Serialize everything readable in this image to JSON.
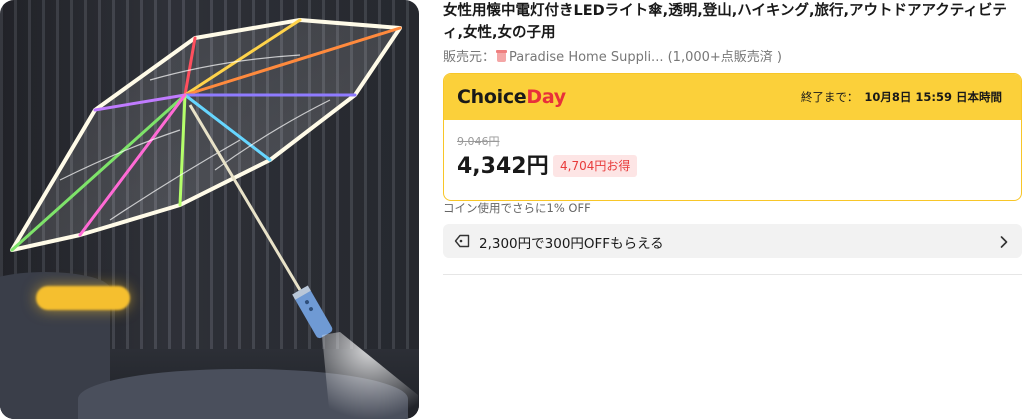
{
  "product": {
    "title": "女性用懐中電灯付きLEDライト傘,透明,登山,ハイキング,旅行,アウトドアアクティビティ,女性,女の子用",
    "seller_prefix": "販売元：",
    "seller_name": "Paradise Home Suppli...",
    "sold_count": "(1,000+点販売済 )"
  },
  "deal": {
    "brand_part1": "Choice",
    "brand_part2": "Day",
    "countdown_label": "終了まで：",
    "countdown_time": "10月8日 15:59 日本時間",
    "original_price": "9,046円",
    "sale_price": "4,342円",
    "savings": "4,704円お得"
  },
  "coin_note": "コイン使用でさらに1% OFF",
  "coupon": {
    "text": "2,300円で300円OFFもらえる"
  },
  "icons": {
    "tag": "tag-icon",
    "chevron": "chevron-right-icon",
    "store": "store-icon"
  },
  "colors": {
    "choice_yellow": "#fbd03a",
    "day_red": "#e8303a",
    "save_text": "#e83a3a",
    "save_bg": "#fde5e5"
  }
}
